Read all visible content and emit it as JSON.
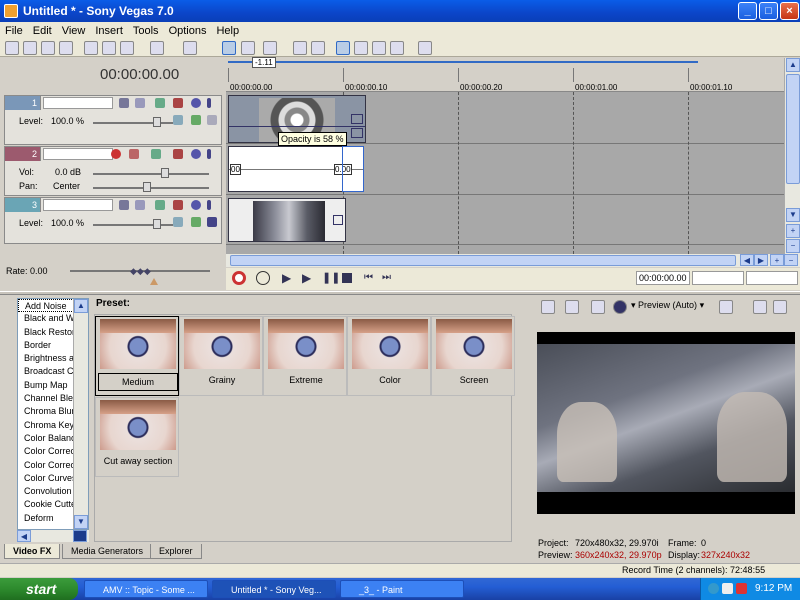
{
  "window": {
    "title": "Untitled * - Sony Vegas 7.0"
  },
  "menu": [
    "File",
    "Edit",
    "View",
    "Insert",
    "Tools",
    "Options",
    "Help"
  ],
  "timecode": "00:00:00.00",
  "ruler": {
    "marker_label": "-1.11",
    "labels": [
      "00:00:00.00",
      "00:00:00.10",
      "00:00:00.20",
      "00:00:01.00",
      "00:00:01.10"
    ]
  },
  "tracks": [
    {
      "number": "1",
      "type": "video",
      "level_label": "Level:",
      "level_value": "100.0 %"
    },
    {
      "number": "2",
      "type": "audio",
      "vol_label": "Vol:",
      "vol_value": "0.0 dB",
      "pan_label": "Pan:",
      "pan_value": "Center"
    },
    {
      "number": "3",
      "type": "video",
      "level_label": "Level:",
      "level_value": "100.0 %"
    }
  ],
  "clip_tooltip": "Opacity is 58 %",
  "audio_fade_labels": [
    "00",
    "0.00"
  ],
  "rate": "Rate: 0.00",
  "transport_time": "00:00:00.00",
  "fx_list": [
    "Add Noise",
    "Black and White",
    "Black Restore",
    "Border",
    "Brightness and Contrast",
    "Broadcast Colors",
    "Bump Map",
    "Channel Blend",
    "Chroma Blur",
    "Chroma Keyer",
    "Color Balance",
    "Color Corrector",
    "Color Corrector (Secondary)",
    "Color Curves",
    "Convolution Kernel",
    "Cookie Cutter",
    "Deform"
  ],
  "preset_heading": "Preset:",
  "presets": [
    "Medium",
    "Grainy",
    "Extreme",
    "Color",
    "Screen",
    "Cut away section"
  ],
  "preview_toolbar": {
    "mode": "Preview (Auto)"
  },
  "preview_info": {
    "project_label": "Project:",
    "project_value": "720x480x32, 29.970i",
    "frame_label": "Frame:",
    "frame_value": "0",
    "preview_label": "Preview:",
    "preview_value": "360x240x32, 29.970p",
    "display_label": "Display:",
    "display_value": "327x240x32"
  },
  "tabs": [
    "Video FX",
    "Media Generators",
    "Explorer"
  ],
  "status": "Record Time (2 channels): 72:48:55",
  "taskbar": {
    "start": "start",
    "tasks": [
      "AMV :: Topic - Some ...",
      "Untitled * - Sony Veg...",
      "_3_ - Paint"
    ],
    "clock": "9:12 PM"
  },
  "colors": {
    "title_bar": "#0b45c8",
    "track_video": "#7a97b8",
    "track_audio": "#9c5a6e",
    "track3": "#6aa5b5"
  }
}
